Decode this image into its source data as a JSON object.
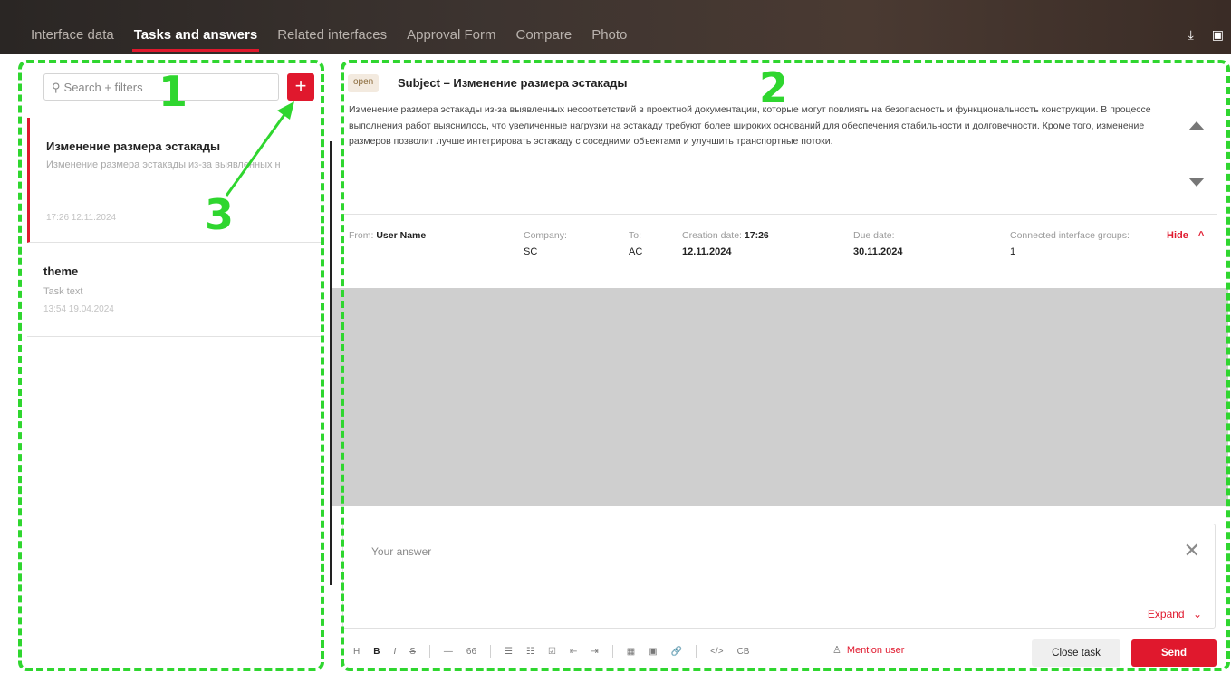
{
  "tabs": [
    "Interface data",
    "Tasks and answers",
    "Related interfaces",
    "Approval Form",
    "Compare",
    "Photo"
  ],
  "active_tab": "Tasks and answers",
  "top_icons": [
    "download-icon",
    "calendar-icon"
  ],
  "search": {
    "placeholder": "Search + filters",
    "add_label": "+"
  },
  "tasks": [
    {
      "title": "Изменение размера эстакады",
      "subtitle": "Изменение размера эстакады из-за выявленных н",
      "time": "17:26 12.11.2024"
    },
    {
      "title": "theme",
      "subtitle": "Task text",
      "time": "13:54 19.04.2024"
    }
  ],
  "detail": {
    "status": "open",
    "subject": "Subject – Изменение размера эстакады",
    "description": "Изменение размера эстакады из-за выявленных несоответствий в проектной документации, которые могут повлиять на безопасность и функциональность конструкции. В процессе выполнения работ выяснилось, что увеличенные нагрузки на эстакаду требуют более широких оснований для обеспечения стабильности и долговечности. Кроме того, изменение размеров позволит лучше интегрировать эстакаду с соседними объектами и улучшить транспортные потоки.",
    "from_label": "From:",
    "from_value": "User Name",
    "company_label": "Company:",
    "company_value": "SC",
    "to_label": "To:",
    "to_value": "AC",
    "creation_label": "Creation date:",
    "creation_time": "17:26",
    "creation_date": "12.11.2024",
    "due_label": "Due date:",
    "due_value": "30.11.2024",
    "groups_label": "Connected interface groups:",
    "groups_value": "1",
    "hide_label": "Hide"
  },
  "answer": {
    "placeholder": "Your answer",
    "expand_label": "Expand"
  },
  "toolbar": {
    "items": [
      "H",
      "B",
      "I",
      "S",
      "—",
      "66",
      "☰",
      "☷",
      "☑",
      "⇤",
      "⇥",
      "▦",
      "▣",
      "🔗",
      "</>",
      "CB"
    ],
    "mention_label": "Mention user",
    "close_label": "Close task",
    "send_label": "Send"
  },
  "annotations": {
    "n1": "1",
    "n2": "2",
    "n3": "3"
  },
  "colors": {
    "accent": "#e0182d",
    "annotation": "#2fd62f"
  }
}
